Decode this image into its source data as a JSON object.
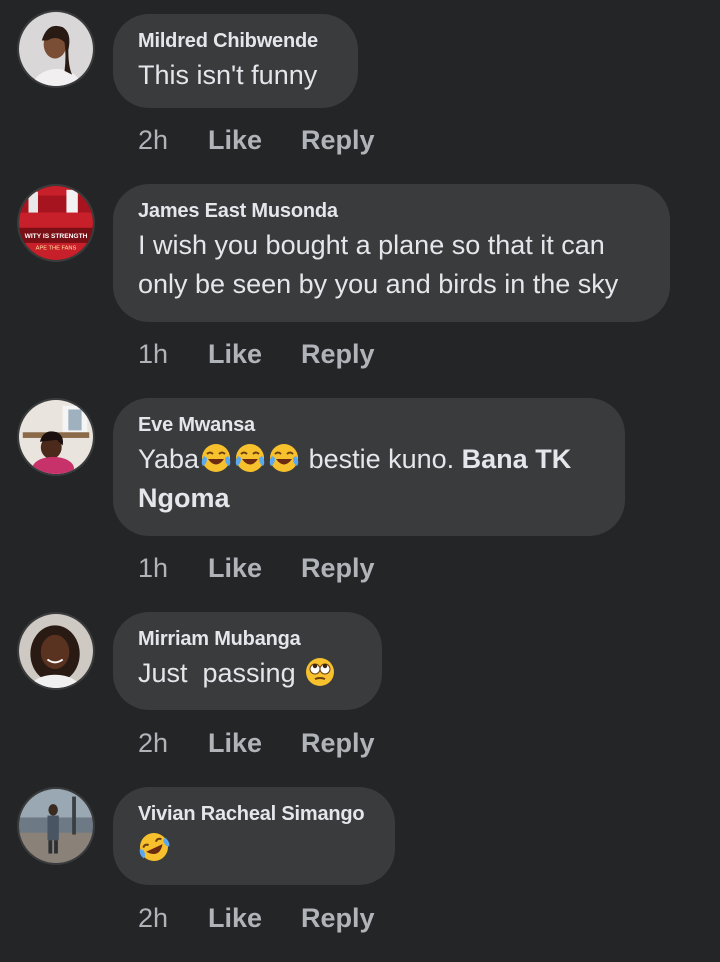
{
  "comments": [
    {
      "author": "Mildred Chibwende",
      "text": "This isn't funny",
      "time": "2h",
      "like_label": "Like",
      "reply_label": "Reply"
    },
    {
      "author": "James East Musonda",
      "text_line1": "I wish you bought a plane so that it can",
      "text_line2": "only be seen by you and birds in the sky",
      "avatar_text_1": "WITY IS STRENGTH",
      "avatar_text_2": "APE THE FANS",
      "time": "1h",
      "like_label": "Like",
      "reply_label": "Reply"
    },
    {
      "author": "Eve Mwansa",
      "text_pre": "Yaba",
      "text_mid": " bestie kuno. ",
      "text_bold_1": "Bana TK",
      "text_bold_2": "Ngoma",
      "emojis": [
        "face-with-tears-of-joy",
        "face-with-tears-of-joy",
        "face-with-tears-of-joy"
      ],
      "time": "1h",
      "like_label": "Like",
      "reply_label": "Reply"
    },
    {
      "author": "Mirriam Mubanga",
      "text": "Just  passing ",
      "emojis": [
        "face-with-rolling-eyes"
      ],
      "time": "2h",
      "like_label": "Like",
      "reply_label": "Reply"
    },
    {
      "author": "Vivian Racheal Simango",
      "emojis": [
        "rolling-on-the-floor-laughing"
      ],
      "time": "2h",
      "like_label": "Like",
      "reply_label": "Reply"
    }
  ],
  "colors": {
    "background": "#242526",
    "bubble": "#3a3b3c",
    "primary_text": "#e4e6eb",
    "secondary_text": "#b0b3b8"
  }
}
